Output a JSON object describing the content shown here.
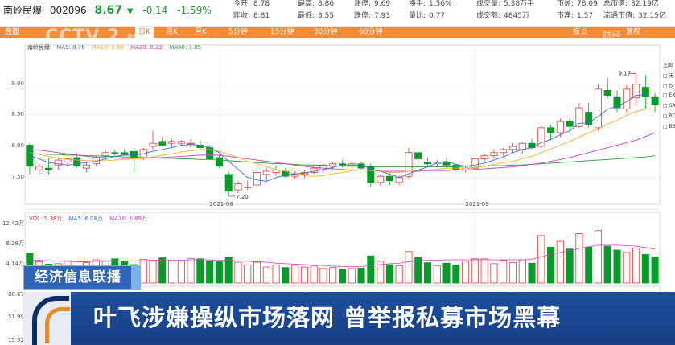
{
  "stock": {
    "name": "南岭民爆",
    "code": "002096",
    "price": "8.67",
    "arrow": "▼",
    "change": "-0.14",
    "change_pct": "-1.59%"
  },
  "quote_items": [
    {
      "label": "今开",
      "value": "8.78"
    },
    {
      "label": "最高",
      "value": "8.86"
    },
    {
      "label": "涨停",
      "value": "9.69"
    },
    {
      "label": "换手",
      "value": "1.56%"
    },
    {
      "label": "成交量",
      "value": "5.38万手"
    },
    {
      "label": "市盈",
      "value": "78.09"
    },
    {
      "label": "总市值",
      "value": "32.19亿"
    },
    {
      "label": "昨收",
      "value": "8.81"
    },
    {
      "label": "最低",
      "value": "8.55"
    },
    {
      "label": "跌停",
      "value": "7.93"
    },
    {
      "label": "量比",
      "value": "0.77"
    },
    {
      "label": "成交额",
      "value": "4845万"
    },
    {
      "label": "市净",
      "value": "1.57"
    },
    {
      "label": "流通市值",
      "value": "32.15亿"
    }
  ],
  "menu": {
    "tabs": [
      "盘面",
      "日K",
      "周K",
      "月K",
      "5分钟",
      "15分钟",
      "30分钟",
      "60分钟"
    ],
    "active": "日K",
    "right": [
      "扳长",
      "复权"
    ]
  },
  "watermark": {
    "left": "CCTV 2",
    "left_sub": "财经",
    "right": "财经"
  },
  "ma_legend": {
    "name": "南岭民爆",
    "ma5": "MA5: 8.76",
    "ma10": "MA10: 8.60",
    "ma20": "MA20: 8.22",
    "ma60": "MA60: 7.85"
  },
  "vol_legend": {
    "vol": "VOL: 5.38万",
    "ma5": "MA5: 6.08万",
    "ma10": "MA10: 6.89万"
  },
  "right_panel": [
    "主图",
    "无",
    "均",
    "EX",
    "SA",
    "BO",
    "BB"
  ],
  "colors": {
    "up": "#e03a3a",
    "down": "#0a9a2a",
    "ma5": "#3a6fd0",
    "ma10": "#f0b030",
    "ma20": "#d040c0",
    "ma60": "#2a9a3a"
  },
  "chart_data": {
    "type": "candlestick",
    "price_axis": {
      "ticks": [
        "9.00",
        "8.50",
        "8.00",
        "7.50"
      ],
      "ylim": [
        7.07,
        9.5
      ]
    },
    "volume_axis": {
      "ticks": [
        "12.42万",
        "8.28万",
        "4.14万"
      ]
    },
    "macd_axis": {
      "ticks": [
        "88.67",
        "51.99",
        "15.32"
      ]
    },
    "x_labels": [
      "2021-08",
      "2021-09"
    ],
    "annotations": [
      {
        "text": "7.20"
      },
      {
        "text": "9.17"
      }
    ],
    "candles": [
      {
        "o": 8.02,
        "h": 8.05,
        "l": 7.55,
        "c": 7.68
      },
      {
        "o": 7.62,
        "h": 7.72,
        "l": 7.55,
        "c": 7.68
      },
      {
        "o": 7.65,
        "h": 7.82,
        "l": 7.55,
        "c": 7.63
      },
      {
        "o": 7.7,
        "h": 7.8,
        "l": 7.62,
        "c": 7.78
      },
      {
        "o": 7.75,
        "h": 7.82,
        "l": 7.68,
        "c": 7.8
      },
      {
        "o": 7.82,
        "h": 7.9,
        "l": 7.65,
        "c": 7.68
      },
      {
        "o": 7.65,
        "h": 7.75,
        "l": 7.58,
        "c": 7.7
      },
      {
        "o": 7.72,
        "h": 7.85,
        "l": 7.68,
        "c": 7.82
      },
      {
        "o": 7.85,
        "h": 7.95,
        "l": 7.78,
        "c": 7.9
      },
      {
        "o": 7.9,
        "h": 7.95,
        "l": 7.85,
        "c": 7.88
      },
      {
        "o": 7.9,
        "h": 7.95,
        "l": 7.85,
        "c": 7.87
      },
      {
        "o": 7.92,
        "h": 7.98,
        "l": 7.58,
        "c": 7.82
      },
      {
        "o": 7.82,
        "h": 7.98,
        "l": 7.78,
        "c": 7.95
      },
      {
        "o": 8.0,
        "h": 8.25,
        "l": 7.95,
        "c": 8.05
      },
      {
        "o": 8.08,
        "h": 8.15,
        "l": 8.0,
        "c": 8.02
      },
      {
        "o": 8.05,
        "h": 8.12,
        "l": 7.98,
        "c": 8.08
      },
      {
        "o": 8.05,
        "h": 8.1,
        "l": 8.0,
        "c": 8.08
      },
      {
        "o": 8.05,
        "h": 8.12,
        "l": 7.98,
        "c": 8.05
      },
      {
        "o": 8.02,
        "h": 8.1,
        "l": 7.95,
        "c": 7.98
      },
      {
        "o": 7.98,
        "h": 8.02,
        "l": 7.78,
        "c": 7.8
      },
      {
        "o": 7.82,
        "h": 7.85,
        "l": 7.65,
        "c": 7.68
      },
      {
        "o": 7.55,
        "h": 7.6,
        "l": 7.2,
        "c": 7.28
      },
      {
        "o": 7.3,
        "h": 7.45,
        "l": 7.25,
        "c": 7.4
      },
      {
        "o": 7.35,
        "h": 7.45,
        "l": 7.3,
        "c": 7.35
      },
      {
        "o": 7.38,
        "h": 7.62,
        "l": 7.32,
        "c": 7.58
      },
      {
        "o": 7.55,
        "h": 7.65,
        "l": 7.45,
        "c": 7.6
      },
      {
        "o": 7.58,
        "h": 7.68,
        "l": 7.52,
        "c": 7.62
      },
      {
        "o": 7.6,
        "h": 7.65,
        "l": 7.5,
        "c": 7.52
      },
      {
        "o": 7.52,
        "h": 7.6,
        "l": 7.48,
        "c": 7.55
      },
      {
        "o": 7.55,
        "h": 7.62,
        "l": 7.5,
        "c": 7.58
      },
      {
        "o": 7.58,
        "h": 7.68,
        "l": 7.55,
        "c": 7.65
      },
      {
        "o": 7.62,
        "h": 7.72,
        "l": 7.58,
        "c": 7.7
      },
      {
        "o": 7.68,
        "h": 7.75,
        "l": 7.62,
        "c": 7.72
      },
      {
        "o": 7.72,
        "h": 7.78,
        "l": 7.66,
        "c": 7.7
      },
      {
        "o": 7.7,
        "h": 7.75,
        "l": 7.65,
        "c": 7.72
      },
      {
        "o": 7.72,
        "h": 7.76,
        "l": 7.62,
        "c": 7.65
      },
      {
        "o": 7.68,
        "h": 7.72,
        "l": 7.35,
        "c": 7.42
      },
      {
        "o": 7.42,
        "h": 7.55,
        "l": 7.38,
        "c": 7.52
      },
      {
        "o": 7.52,
        "h": 7.58,
        "l": 7.38,
        "c": 7.45
      },
      {
        "o": 7.42,
        "h": 7.55,
        "l": 7.38,
        "c": 7.5
      },
      {
        "o": 7.52,
        "h": 7.98,
        "l": 7.48,
        "c": 7.9
      },
      {
        "o": 7.9,
        "h": 7.96,
        "l": 7.65,
        "c": 7.8
      },
      {
        "o": 7.75,
        "h": 7.82,
        "l": 7.68,
        "c": 7.72
      },
      {
        "o": 7.72,
        "h": 7.78,
        "l": 7.66,
        "c": 7.75
      },
      {
        "o": 7.75,
        "h": 7.82,
        "l": 7.65,
        "c": 7.7
      },
      {
        "o": 7.7,
        "h": 7.72,
        "l": 7.6,
        "c": 7.62
      },
      {
        "o": 7.62,
        "h": 7.68,
        "l": 7.58,
        "c": 7.65
      },
      {
        "o": 7.65,
        "h": 7.82,
        "l": 7.62,
        "c": 7.8
      },
      {
        "o": 7.8,
        "h": 7.88,
        "l": 7.75,
        "c": 7.85
      },
      {
        "o": 7.85,
        "h": 7.95,
        "l": 7.8,
        "c": 7.9
      },
      {
        "o": 7.9,
        "h": 7.98,
        "l": 7.85,
        "c": 7.95
      },
      {
        "o": 7.95,
        "h": 8.05,
        "l": 7.9,
        "c": 8.0
      },
      {
        "o": 7.95,
        "h": 8.08,
        "l": 7.88,
        "c": 8.05
      },
      {
        "o": 8.05,
        "h": 8.12,
        "l": 7.95,
        "c": 7.98
      },
      {
        "o": 8.0,
        "h": 8.35,
        "l": 7.98,
        "c": 8.3
      },
      {
        "o": 8.3,
        "h": 8.35,
        "l": 8.1,
        "c": 8.22
      },
      {
        "o": 8.22,
        "h": 8.45,
        "l": 8.15,
        "c": 8.4
      },
      {
        "o": 8.4,
        "h": 8.45,
        "l": 8.25,
        "c": 8.32
      },
      {
        "o": 8.32,
        "h": 8.7,
        "l": 8.3,
        "c": 8.62
      },
      {
        "o": 8.55,
        "h": 8.7,
        "l": 8.3,
        "c": 8.35
      },
      {
        "o": 8.3,
        "h": 9.0,
        "l": 8.25,
        "c": 8.92
      },
      {
        "o": 8.9,
        "h": 9.1,
        "l": 8.78,
        "c": 8.82
      },
      {
        "o": 8.8,
        "h": 8.9,
        "l": 8.55,
        "c": 8.62
      },
      {
        "o": 8.6,
        "h": 8.98,
        "l": 8.55,
        "c": 8.92
      },
      {
        "o": 8.78,
        "h": 9.17,
        "l": 8.65,
        "c": 9.0
      },
      {
        "o": 8.95,
        "h": 9.15,
        "l": 8.6,
        "c": 8.8
      },
      {
        "o": 8.8,
        "h": 8.86,
        "l": 8.55,
        "c": 8.67
      }
    ],
    "ma5": [
      7.85,
      7.8,
      7.74,
      7.72,
      7.7,
      7.72,
      7.74,
      7.76,
      7.8,
      7.84,
      7.86,
      7.86,
      7.88,
      7.92,
      7.95,
      7.98,
      8.02,
      8.03,
      8.02,
      7.98,
      7.9,
      7.76,
      7.63,
      7.5,
      7.46,
      7.44,
      7.5,
      7.54,
      7.56,
      7.57,
      7.6,
      7.63,
      7.66,
      7.7,
      7.7,
      7.7,
      7.64,
      7.6,
      7.55,
      7.5,
      7.56,
      7.62,
      7.67,
      7.74,
      7.76,
      7.71,
      7.68,
      7.7,
      7.73,
      7.78,
      7.83,
      7.9,
      7.95,
      7.98,
      8.06,
      8.11,
      8.19,
      8.25,
      8.37,
      8.38,
      8.48,
      8.6,
      8.64,
      8.72,
      8.82,
      8.83,
      8.76
    ],
    "ma10": [
      7.9,
      7.87,
      7.84,
      7.81,
      7.79,
      7.78,
      7.77,
      7.77,
      7.77,
      7.78,
      7.79,
      7.8,
      7.81,
      7.83,
      7.86,
      7.88,
      7.91,
      7.93,
      7.95,
      7.95,
      7.92,
      7.87,
      7.82,
      7.76,
      7.72,
      7.67,
      7.63,
      7.6,
      7.56,
      7.53,
      7.52,
      7.53,
      7.56,
      7.58,
      7.61,
      7.62,
      7.61,
      7.6,
      7.58,
      7.58,
      7.6,
      7.61,
      7.62,
      7.63,
      7.65,
      7.65,
      7.65,
      7.66,
      7.68,
      7.71,
      7.74,
      7.76,
      7.8,
      7.84,
      7.9,
      7.96,
      8.02,
      8.08,
      8.15,
      8.22,
      8.28,
      8.36,
      8.42,
      8.5,
      8.56,
      8.6,
      8.6
    ],
    "ma20": [
      7.95,
      7.94,
      7.92,
      7.9,
      7.88,
      7.86,
      7.84,
      7.83,
      7.82,
      7.81,
      7.81,
      7.81,
      7.81,
      7.82,
      7.82,
      7.83,
      7.84,
      7.85,
      7.86,
      7.86,
      7.86,
      7.84,
      7.82,
      7.8,
      7.78,
      7.76,
      7.74,
      7.72,
      7.7,
      7.68,
      7.66,
      7.65,
      7.64,
      7.63,
      7.62,
      7.62,
      7.61,
      7.6,
      7.6,
      7.6,
      7.6,
      7.6,
      7.61,
      7.61,
      7.61,
      7.62,
      7.62,
      7.63,
      7.64,
      7.65,
      7.66,
      7.67,
      7.69,
      7.71,
      7.73,
      7.76,
      7.79,
      7.82,
      7.86,
      7.9,
      7.94,
      7.98,
      8.02,
      8.06,
      8.1,
      8.16,
      8.22
    ],
    "ma60": [
      7.88,
      7.88,
      7.87,
      7.87,
      7.86,
      7.86,
      7.85,
      7.85,
      7.84,
      7.84,
      7.83,
      7.83,
      7.82,
      7.82,
      7.81,
      7.81,
      7.8,
      7.8,
      7.79,
      7.79,
      7.78,
      7.77,
      7.76,
      7.75,
      7.74,
      7.73,
      7.72,
      7.72,
      7.71,
      7.7,
      7.7,
      7.69,
      7.69,
      7.68,
      7.68,
      7.68,
      7.67,
      7.67,
      7.67,
      7.67,
      7.67,
      7.67,
      7.67,
      7.67,
      7.67,
      7.67,
      7.68,
      7.68,
      7.68,
      7.69,
      7.69,
      7.7,
      7.7,
      7.71,
      7.72,
      7.73,
      7.74,
      7.75,
      7.76,
      7.77,
      7.78,
      7.79,
      7.8,
      7.81,
      7.82,
      7.83,
      7.85
    ],
    "volume": [
      6.2,
      4.4,
      3.9,
      4.0,
      4.6,
      3.5,
      4.2,
      4.8,
      4.6,
      5.0,
      4.5,
      3.8,
      4.9,
      4.7,
      5.2,
      4.6,
      4.5,
      5.1,
      5.0,
      4.6,
      4.4,
      5.3,
      4.3,
      3.7,
      4.3,
      3.3,
      3.7,
      3.2,
      3.7,
      3.3,
      3.5,
      3.0,
      3.2,
      2.9,
      3.0,
      3.1,
      5.6,
      4.5,
      3.8,
      3.6,
      6.5,
      5.3,
      4.2,
      3.6,
      4.1,
      3.7,
      4.5,
      5.0,
      5.0,
      4.0,
      4.7,
      4.2,
      4.8,
      4.1,
      9.8,
      7.4,
      8.6,
      7.0,
      10.2,
      7.4,
      10.8,
      7.6,
      6.8,
      6.3,
      7.2,
      5.9,
      5.38
    ],
    "vol_ma": [
      4.8,
      4.7,
      4.6,
      4.5,
      4.5,
      4.4,
      4.4,
      4.5,
      4.5,
      4.6,
      4.6,
      4.6,
      4.6,
      4.7,
      4.7,
      4.7,
      4.7,
      4.8,
      4.8,
      4.8,
      4.7,
      4.7,
      4.6,
      4.5,
      4.4,
      4.3,
      4.1,
      4.0,
      3.9,
      3.8,
      3.7,
      3.6,
      3.5,
      3.4,
      3.4,
      3.4,
      3.6,
      3.8,
      4.0,
      4.1,
      4.4,
      4.6,
      4.7,
      4.7,
      4.8,
      4.8,
      4.8,
      4.8,
      4.8,
      4.8,
      4.8,
      4.8,
      4.8,
      4.9,
      5.4,
      5.9,
      6.3,
      6.7,
      7.1,
      7.5,
      7.8,
      7.8,
      7.8,
      7.7,
      7.6,
      7.3,
      7.0
    ]
  },
  "program_tag": "经济信息联播",
  "headline": "叶飞涉嫌操纵市场落网 曾举报私募市场黑幕"
}
